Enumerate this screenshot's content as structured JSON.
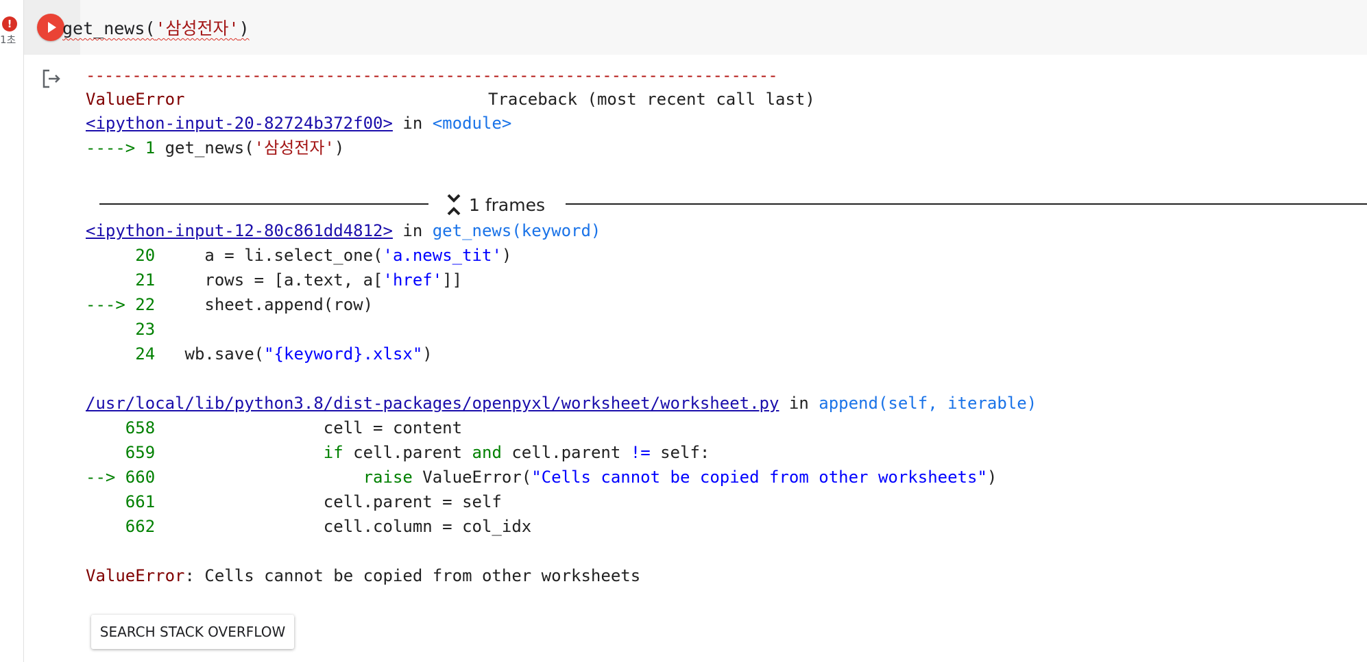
{
  "gutter": {
    "error_badge": "!",
    "exec_time": "1초"
  },
  "cell": {
    "code_fn": "get_news(",
    "code_arg": "'삼성전자'",
    "code_close": ")"
  },
  "traceback": {
    "dashes": "---------------------------------------------------------------------------",
    "error_type": "ValueError",
    "header_right": "Traceback (most recent call last)",
    "frame0": {
      "file": "<ipython-input-20-82724b372f00>",
      "in_text": " in ",
      "func": "<module>",
      "arrow": "----> 1 ",
      "code_fn": "get_news(",
      "code_arg": "'삼성전자'",
      "code_close": ")"
    },
    "frames_label": "1 frames",
    "frame1": {
      "file": "<ipython-input-12-80c861dd4812>",
      "in_text": " in ",
      "func": "get_news",
      "args": "(keyword)",
      "lines": [
        {
          "prefix": "     ",
          "num": "20",
          "code_a": "     a = li.select_one(",
          "code_b": "'a.news_tit'",
          "code_c": ")"
        },
        {
          "prefix": "     ",
          "num": "21",
          "code_a": "     rows = [a.text, a[",
          "code_b": "'href'",
          "code_c": "]]"
        },
        {
          "prefix": "---> ",
          "num": "22",
          "code_a": "     sheet.append(row)",
          "code_b": "",
          "code_c": ""
        },
        {
          "prefix": "     ",
          "num": "23",
          "code_a": "",
          "code_b": "",
          "code_c": ""
        },
        {
          "prefix": "     ",
          "num": "24",
          "code_a": "   wb.save(",
          "code_b": "\"{keyword}.xlsx\"",
          "code_c": ")"
        }
      ]
    },
    "frame2": {
      "file": "/usr/local/lib/python3.8/dist-packages/openpyxl/worksheet/worksheet.py",
      "in_text": " in ",
      "func": "append",
      "args": "(self, iterable)",
      "l658_prefix": "    ",
      "l658_num": "658",
      "l658_code": "                 cell = content",
      "l659_prefix": "    ",
      "l659_num": "659",
      "l659_kw": "                 if",
      "l659_mid": " cell.parent ",
      "l659_and": "and",
      "l659_rest": " cell.parent ",
      "l659_ne": "!=",
      "l659_end": " self:",
      "l660_prefix": "--> ",
      "l660_num": "660",
      "l660_raise": "                     raise",
      "l660_call": " ValueError(",
      "l660_str": "\"Cells cannot be copied from other worksheets\"",
      "l660_close": ")",
      "l661_prefix": "    ",
      "l661_num": "661",
      "l661_code": "                 cell.parent = self",
      "l662_prefix": "    ",
      "l662_num": "662",
      "l662_code": "                 cell.column = col_idx"
    },
    "final_type": "ValueError",
    "final_msg": ": Cells cannot be copied from other worksheets"
  },
  "actions": {
    "search_so": "SEARCH STACK OVERFLOW"
  },
  "icons": {
    "run": "play-icon",
    "output": "output-exit-icon",
    "frames": "collapse-frames-icon"
  },
  "colors": {
    "run_button": "#ea4335",
    "error_dark_red": "#7f0000",
    "link": "#1a0dab",
    "keyword_green": "#008000",
    "string_blue": "#0000ff"
  }
}
